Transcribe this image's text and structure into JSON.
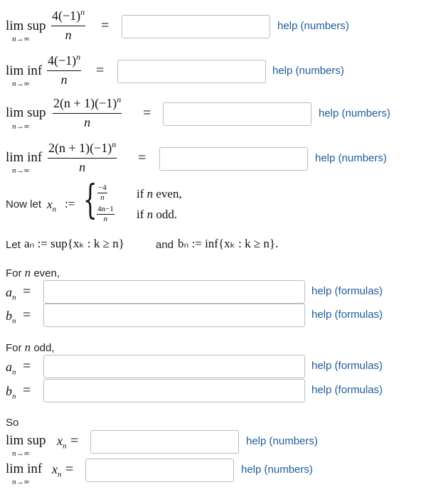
{
  "limit_rows": [
    {
      "op": "lim sup",
      "sub": "n→∞",
      "numerator": "4(−1)",
      "power": "n",
      "denominator": "n",
      "value": "",
      "help": "help (numbers)"
    },
    {
      "op": "lim inf",
      "sub": "n→∞",
      "numerator": "4(−1)",
      "power": "n",
      "denominator": "n",
      "value": "",
      "help": "help (numbers)"
    },
    {
      "op": "lim sup",
      "sub": "n→∞",
      "numerator": "2(n + 1)(−1)",
      "power": "n",
      "denominator": "n",
      "value": "",
      "help": "help (numbers)"
    },
    {
      "op": "lim inf",
      "sub": "n→∞",
      "numerator": "2(n + 1)(−1)",
      "power": "n",
      "denominator": "n",
      "value": "",
      "help": "help (numbers)"
    }
  ],
  "equals": "=",
  "piecewise": {
    "lead": "Now let",
    "var": "x",
    "var_sub": "n",
    "assign": ":=",
    "case1_num": "−4",
    "case1_den": "n",
    "case1_cond_pre": "if ",
    "case1_cond_var": "n",
    "case1_cond_post": " even,",
    "case2_num": "4n−1",
    "case2_den": "n",
    "case2_cond_pre": "if ",
    "case2_cond_var": "n",
    "case2_cond_post": " odd."
  },
  "definition": {
    "lead": "Let",
    "a_def": "aₙ := sup{xₖ : k ≥ n}",
    "and": "and",
    "b_def": "bₙ := inf{xₖ : k ≥ n}."
  },
  "even_section": {
    "heading_pre": "For ",
    "heading_var": "n",
    "heading_post": " even,",
    "a_label": "a",
    "b_label": "b",
    "label_sub": "n",
    "a_value": "",
    "b_value": "",
    "help": "help (formulas)"
  },
  "odd_section": {
    "heading_pre": "For ",
    "heading_var": "n",
    "heading_post": " odd,",
    "a_label": "a",
    "b_label": "b",
    "label_sub": "n",
    "a_value": "",
    "b_value": "",
    "help": "help (formulas)"
  },
  "conclusion": {
    "lead": "So",
    "sup_op": "lim sup",
    "inf_op": "lim inf",
    "sub": "n→∞",
    "var": "x",
    "var_sub": "n",
    "sup_value": "",
    "inf_value": "",
    "help": "help (numbers)"
  }
}
